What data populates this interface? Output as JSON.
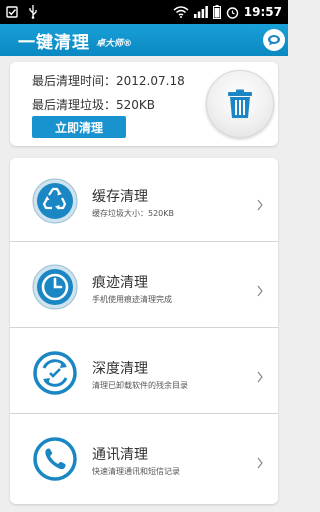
{
  "status_bar": {
    "time": "19:57",
    "icons": [
      "notification-icon",
      "usb-icon",
      "wifi-icon",
      "signal-icon",
      "battery-icon",
      "alarm-icon"
    ]
  },
  "header": {
    "title": "一键清理",
    "brand": "卓大师®",
    "chat_icon": "chat-bubble-icon"
  },
  "summary": {
    "last_clean_time": "最后清理时间：2012.07.18",
    "last_clean_junk": "最后清理垃圾：520KB",
    "clean_button": "立即清理",
    "trash_icon": "trash-icon"
  },
  "items": [
    {
      "title": "缓存清理",
      "subtitle": "缓存垃圾大小：520KB",
      "icon": "recycle-icon"
    },
    {
      "title": "痕迹清理",
      "subtitle": "手机使用痕迹清理完成",
      "icon": "clock-icon"
    },
    {
      "title": "深度清理",
      "subtitle": "清理已卸载软件的残余目录",
      "icon": "refresh-icon"
    },
    {
      "title": "通讯清理",
      "subtitle": "快速清理通讯和短信记录",
      "icon": "phone-icon"
    }
  ],
  "colors": {
    "accent": "#0a88c2",
    "button": "#1993cf",
    "icon_ring": "#1a87c4"
  }
}
